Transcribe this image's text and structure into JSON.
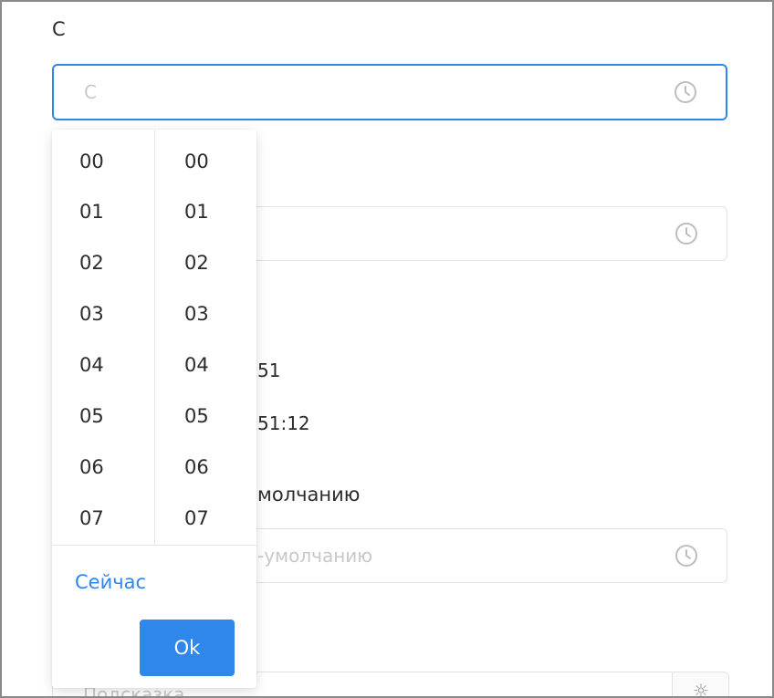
{
  "form": {
    "from_label": "С",
    "from_placeholder": "С",
    "seconds_value_partial": "51",
    "time_value_partial": "51:12",
    "default_label_partial": "молчанию",
    "default_placeholder_partial": "-умолчанию",
    "bottom_placeholder_partial": "Подсказка"
  },
  "picker": {
    "hours": [
      "00",
      "01",
      "02",
      "03",
      "04",
      "05",
      "06",
      "07"
    ],
    "minutes": [
      "00",
      "01",
      "02",
      "03",
      "04",
      "05",
      "06",
      "07"
    ],
    "now_label": "Сейчас",
    "ok_label": "Ok"
  },
  "icons": {
    "clock": "clock-icon",
    "settings": "settings-icon"
  },
  "colors": {
    "accent": "#2f86eb",
    "placeholder": "#c8c8c8",
    "border": "#e2e2e2"
  }
}
